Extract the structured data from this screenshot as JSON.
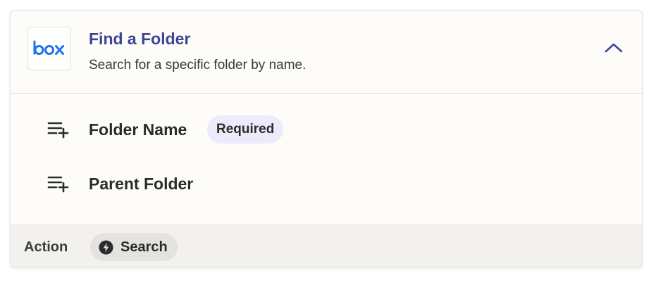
{
  "step": {
    "app_logo": "box-logo",
    "app_logo_text": "box",
    "title": "Find a Folder",
    "subtitle": "Search for a specific folder by name.",
    "collapse_icon": "chevron-up-icon"
  },
  "fields": [
    {
      "label": "Folder Name",
      "badge": "Required",
      "icon": "add-list-icon"
    },
    {
      "label": "Parent Folder",
      "icon": "add-list-icon"
    }
  ],
  "footer": {
    "type_label": "Action",
    "chip_label": "Search",
    "chip_icon": "bolt-icon"
  },
  "colors": {
    "title": "#3d4494",
    "box_brand": "#1a73e8",
    "badge_bg": "#ecebfb",
    "footer_bg": "#f2f1ed"
  }
}
